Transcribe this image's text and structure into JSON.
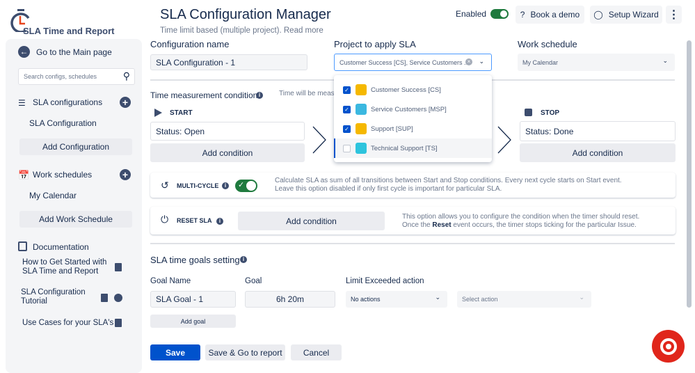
{
  "app": {
    "logo_text": "SLA Time and Report",
    "title": "SLA Configuration Manager",
    "subtitle": "Time limit based (multiple project). Read more"
  },
  "header": {
    "enabled_label": "Enabled",
    "enabled": true,
    "book_demo": "Book a demo",
    "setup_wizard": "Setup Wizard"
  },
  "sidebar": {
    "back": "Go to the Main page",
    "search_placeholder": "Search configs, schedules",
    "sla_configs": "SLA configurations",
    "sla_config_item": "SLA Configuration",
    "add_config": "Add Configuration",
    "work_schedules": "Work schedules",
    "calendar_item": "My Calendar",
    "add_schedule": "Add Work Schedule",
    "documentation": "Documentation",
    "docs": [
      "How to Get Started with SLA Time and Report",
      "SLA Configuration Tutorial",
      "Use Cases for your SLA's"
    ]
  },
  "form": {
    "config_name_label": "Configuration name",
    "config_name_value": "SLA Configuration - 1",
    "project_label": "Project to apply SLA",
    "project_value": "Customer Success [CS], Service Customers ...",
    "schedule_label": "Work schedule",
    "schedule_value": "My Calendar",
    "projects": [
      {
        "name": "Customer Success [CS]",
        "checked": true,
        "color": "#f5b800"
      },
      {
        "name": "Service Customers [MSP]",
        "checked": true,
        "color": "#3bb8e0"
      },
      {
        "name": "Support [SUP]",
        "checked": true,
        "color": "#f5b800"
      },
      {
        "name": "Technical Support [TS]",
        "checked": false,
        "color": "#2ec4dd"
      }
    ]
  },
  "conditions": {
    "title": "Time measurement conditions",
    "hint": "Time will be measu",
    "start": "START",
    "start_value": "Status: Open",
    "stop": "STOP",
    "stop_value": "Status: Done",
    "add_condition": "Add condition"
  },
  "multicycle": {
    "label": "MULTI-CYCLE",
    "enabled": true,
    "desc1": "Calculate SLA as sum of all transitions between Start and Stop conditions. Every next cycle starts on Start event.",
    "desc2": "Leave this option disabled if only first cycle is important for particular SLA."
  },
  "reset": {
    "label": "RESET SLA",
    "add_condition": "Add condition",
    "desc1": "This option allows you to configure the condition when the timer should reset.",
    "desc2_pre": "Once the ",
    "desc2_bold": "Reset",
    "desc2_post": " event occurs, the timer stops ticking for the particular Issue."
  },
  "goals": {
    "title": "SLA time goals setting",
    "col_name": "Goal Name",
    "col_goal": "Goal",
    "col_action": "Limit Exceeded action",
    "name_value": "SLA Goal - 1",
    "goal_value": "6h 20m",
    "action_value": "No actions",
    "select_placeholder": "Select action",
    "add_goal": "Add goal"
  },
  "footer": {
    "save": "Save",
    "save_report": "Save & Go to report",
    "cancel": "Cancel"
  },
  "colors": {
    "primary": "#0052cc",
    "chat": "#e0261b",
    "toggle": "#1f7a3e"
  }
}
